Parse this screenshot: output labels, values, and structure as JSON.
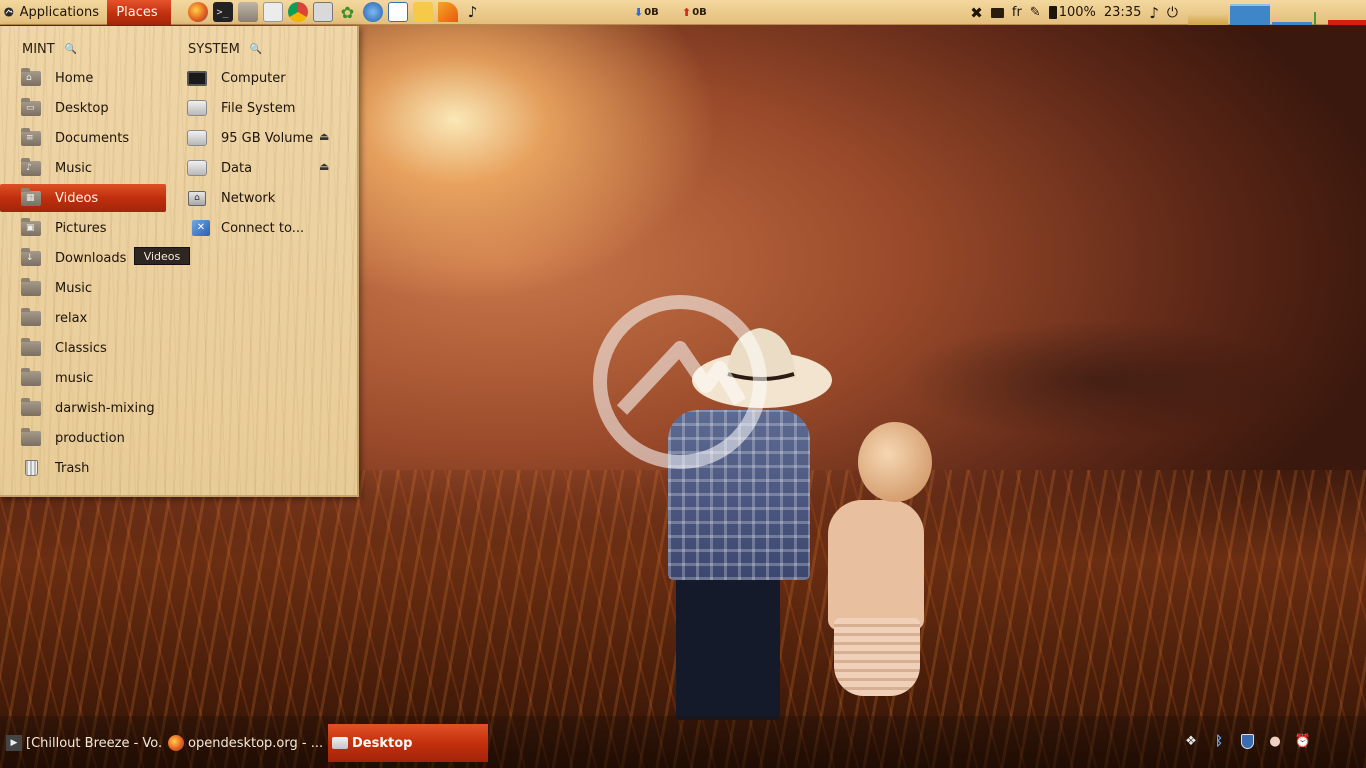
{
  "top_panel": {
    "applications_label": "Applications",
    "places_label": "Places",
    "launchers": [
      "firefox-icon",
      "terminal-icon",
      "files-icon",
      "calculator-icon",
      "chrome-icon",
      "screenshot-icon",
      "cannabis-icon",
      "update-icon",
      "text-editor-icon",
      "cheese-icon",
      "slice-icon",
      "music-note-icon"
    ],
    "net_down": "0B",
    "net_up": "0B",
    "keyboard_layout": "fr",
    "battery": "100%",
    "clock": "23:35"
  },
  "places_menu": {
    "mint_header": "MINT",
    "system_header": "SYSTEM",
    "mint_items": [
      {
        "label": "Home",
        "icon": "home-folder-icon"
      },
      {
        "label": "Desktop",
        "icon": "desktop-folder-icon"
      },
      {
        "label": "Documents",
        "icon": "documents-folder-icon"
      },
      {
        "label": "Music",
        "icon": "music-folder-icon"
      },
      {
        "label": "Videos",
        "icon": "videos-folder-icon"
      },
      {
        "label": "Pictures",
        "icon": "pictures-folder-icon"
      },
      {
        "label": "Downloads",
        "icon": "downloads-folder-icon"
      },
      {
        "label": "Music",
        "icon": "folder-icon"
      },
      {
        "label": "relax",
        "icon": "folder-icon"
      },
      {
        "label": "Classics",
        "icon": "folder-icon"
      },
      {
        "label": "music",
        "icon": "folder-icon"
      },
      {
        "label": "darwish-mixing",
        "icon": "folder-icon"
      },
      {
        "label": "production",
        "icon": "folder-icon"
      },
      {
        "label": "Trash",
        "icon": "trash-icon"
      }
    ],
    "system_items": [
      {
        "label": "Computer",
        "icon": "computer-icon"
      },
      {
        "label": "File System",
        "icon": "drive-icon"
      },
      {
        "label": "95 GB Volume",
        "icon": "drive-icon"
      },
      {
        "label": "Data",
        "icon": "drive-icon"
      },
      {
        "label": "Network",
        "icon": "network-icon"
      },
      {
        "label": "Connect to...",
        "icon": "connect-server-icon"
      }
    ],
    "selected": "Videos",
    "tooltip": "Videos"
  },
  "taskbar": {
    "tasks": [
      {
        "label": "[Chillout Breeze - Vo...",
        "icon": "media-player-icon"
      },
      {
        "label": "opendesktop.org - ...",
        "icon": "firefox-icon"
      },
      {
        "label": "Desktop",
        "icon": "folder-icon"
      }
    ],
    "tray": [
      "dropbox-icon",
      "bluetooth-icon",
      "shield-icon",
      "notification-icon",
      "alarm-clock-icon"
    ]
  },
  "colors": {
    "panel": "#e8c585",
    "accent": "#c9330f",
    "menu_wood": "#ecd29f"
  }
}
